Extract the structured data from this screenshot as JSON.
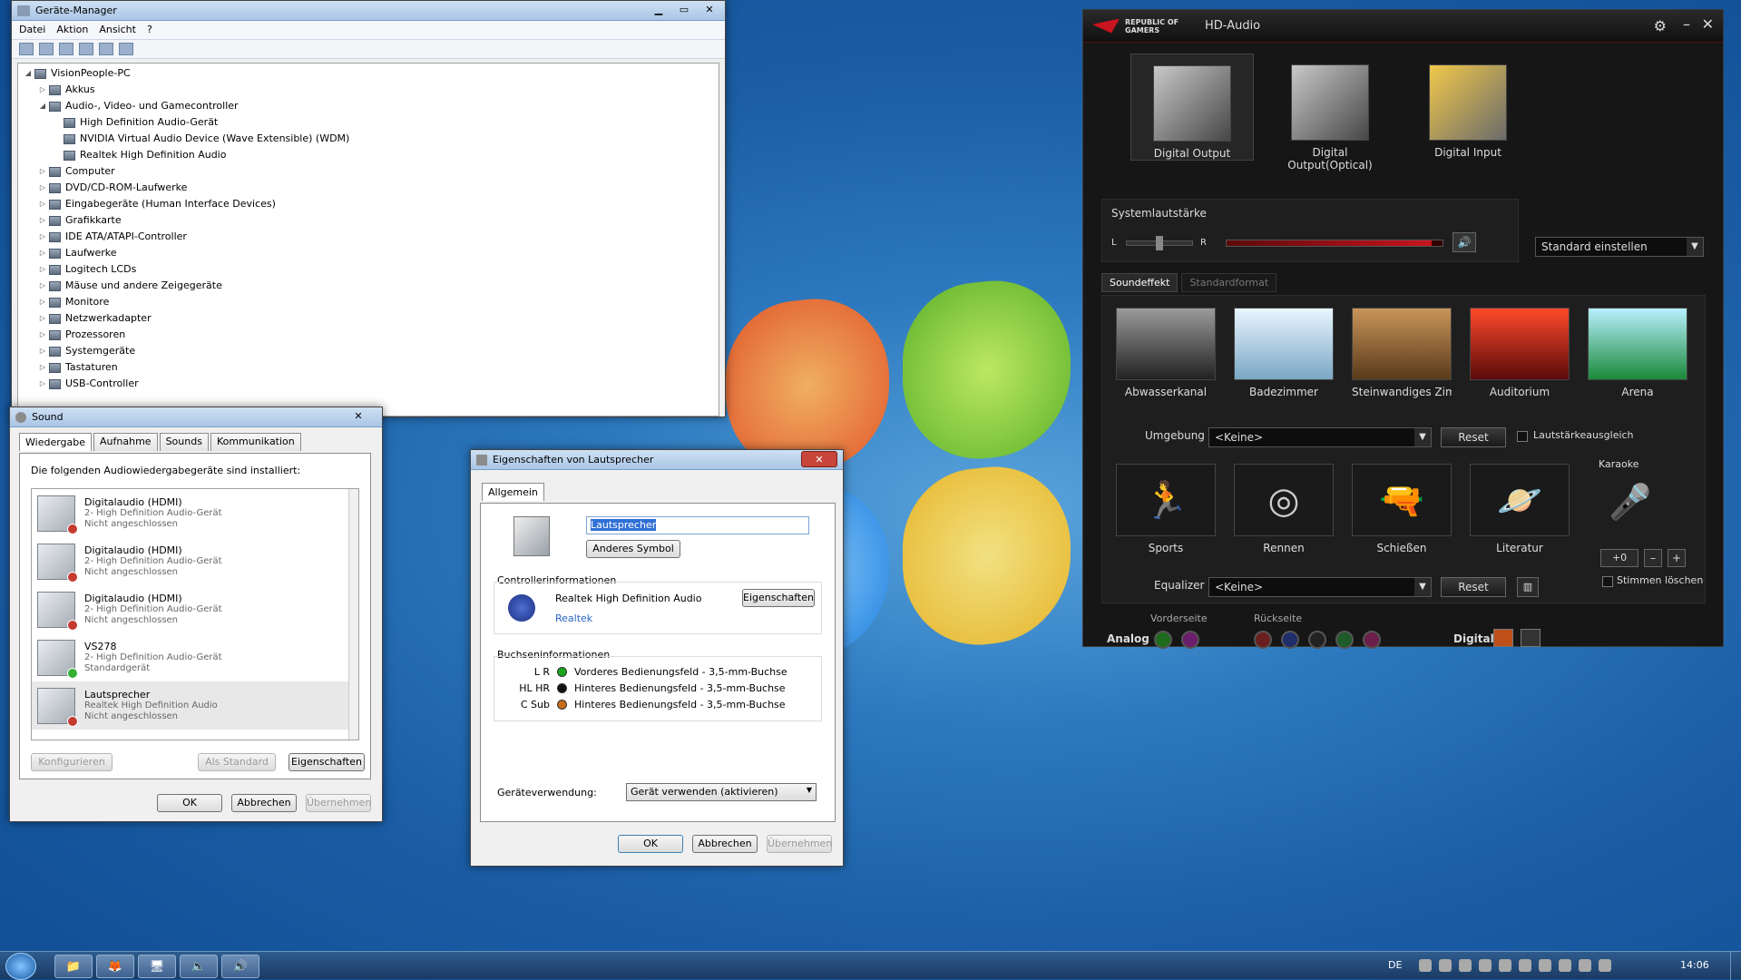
{
  "device_manager": {
    "title": "Geräte-Manager",
    "menu": [
      "Datei",
      "Aktion",
      "Ansicht",
      "?"
    ],
    "tree": [
      {
        "label": "VisionPeople-PC",
        "level": 0,
        "exp": "◢"
      },
      {
        "label": "Akkus",
        "level": 1,
        "exp": "▷"
      },
      {
        "label": "Audio-, Video- und Gamecontroller",
        "level": 1,
        "exp": "◢"
      },
      {
        "label": "High Definition Audio-Gerät",
        "level": 2,
        "exp": ""
      },
      {
        "label": "NVIDIA Virtual Audio Device (Wave Extensible) (WDM)",
        "level": 2,
        "exp": ""
      },
      {
        "label": "Realtek High Definition Audio",
        "level": 2,
        "exp": ""
      },
      {
        "label": "Computer",
        "level": 1,
        "exp": "▷"
      },
      {
        "label": "DVD/CD-ROM-Laufwerke",
        "level": 1,
        "exp": "▷"
      },
      {
        "label": "Eingabegeräte (Human Interface Devices)",
        "level": 1,
        "exp": "▷"
      },
      {
        "label": "Grafikkarte",
        "level": 1,
        "exp": "▷"
      },
      {
        "label": "IDE ATA/ATAPI-Controller",
        "level": 1,
        "exp": "▷"
      },
      {
        "label": "Laufwerke",
        "level": 1,
        "exp": "▷"
      },
      {
        "label": "Logitech LCDs",
        "level": 1,
        "exp": "▷"
      },
      {
        "label": "Mäuse und andere Zeigegeräte",
        "level": 1,
        "exp": "▷"
      },
      {
        "label": "Monitore",
        "level": 1,
        "exp": "▷"
      },
      {
        "label": "Netzwerkadapter",
        "level": 1,
        "exp": "▷"
      },
      {
        "label": "Prozessoren",
        "level": 1,
        "exp": "▷"
      },
      {
        "label": "Systemgeräte",
        "level": 1,
        "exp": "▷"
      },
      {
        "label": "Tastaturen",
        "level": 1,
        "exp": "▷"
      },
      {
        "label": "USB-Controller",
        "level": 1,
        "exp": "▷"
      }
    ]
  },
  "sound": {
    "title": "Sound",
    "tabs": [
      "Wiedergabe",
      "Aufnahme",
      "Sounds",
      "Kommunikation"
    ],
    "intro": "Die folgenden Audiowiedergabegeräte sind installiert:",
    "devices": [
      {
        "name": "Digitalaudio (HDMI)",
        "sub": "2- High Definition Audio-Gerät",
        "status": "Nicht angeschlossen",
        "ok": false
      },
      {
        "name": "Digitalaudio (HDMI)",
        "sub": "2- High Definition Audio-Gerät",
        "status": "Nicht angeschlossen",
        "ok": false
      },
      {
        "name": "Digitalaudio (HDMI)",
        "sub": "2- High Definition Audio-Gerät",
        "status": "Nicht angeschlossen",
        "ok": false
      },
      {
        "name": "VS278",
        "sub": "2- High Definition Audio-Gerät",
        "status": "Standardgerät",
        "ok": true
      },
      {
        "name": "Lautsprecher",
        "sub": "Realtek High Definition Audio",
        "status": "Nicht angeschlossen",
        "ok": false
      }
    ],
    "btn_config": "Konfigurieren",
    "btn_default": "Als Standard",
    "btn_props": "Eigenschaften",
    "ok": "OK",
    "cancel": "Abbrechen",
    "apply": "Übernehmen"
  },
  "props": {
    "title": "Eigenschaften von Lautsprecher",
    "tab": "Allgemein",
    "name_value": "Lautsprecher",
    "btn_symbol": "Anderes Symbol",
    "ctrl_header": "Controllerinformationen",
    "ctrl_name": "Realtek High Definition Audio",
    "ctrl_vendor": "Realtek",
    "btn_ctrl_props": "Eigenschaften",
    "jack_header": "Buchseninformationen",
    "jacks": [
      {
        "ch": "L R",
        "desc": "Vorderes Bedienungsfeld - 3,5-mm-Buchse",
        "color": "#1aa51a"
      },
      {
        "ch": "HL HR",
        "desc": "Hinteres Bedienungsfeld - 3,5-mm-Buchse",
        "color": "#111111"
      },
      {
        "ch": "C Sub",
        "desc": "Hinteres Bedienungsfeld - 3,5-mm-Buchse",
        "color": "#c76a1a"
      }
    ],
    "usage_label": "Geräteverwendung:",
    "usage_value": "Gerät verwenden (aktivieren)",
    "ok": "OK",
    "cancel": "Abbrechen",
    "apply": "Übernehmen"
  },
  "rog": {
    "brand": "REPUBLIC OF GAMERS",
    "title": "HD-Audio",
    "outputs": [
      {
        "label": "Digital Output"
      },
      {
        "label": "Digital Output(Optical)"
      },
      {
        "label": "Digital Input"
      }
    ],
    "vol_label": "Systemlautstärke",
    "vol_l": "L",
    "vol_r": "R",
    "volume_level": 0.95,
    "default_select": "Standard einstellen",
    "tabs": [
      "Soundeffekt",
      "Standardformat"
    ],
    "environments": [
      "Abwasserkanal",
      "Badezimmer",
      "Steinwandiges Zimmer",
      "Auditorium",
      "Arena"
    ],
    "env_label": "Umgebung",
    "env_value": "<Keine>",
    "reset": "Reset",
    "loudness": "Lautstärkeausgleich",
    "eq_presets": [
      "Sports",
      "Rennen",
      "Schießen",
      "Literatur"
    ],
    "karaoke": "Karaoke",
    "karaoke_value": "+0",
    "eq_label": "Equalizer",
    "eq_value": "<Keine>",
    "voice_cancel": "Stimmen löschen",
    "front_label": "Vorderseite",
    "rear_label": "Rückseite",
    "analog": "Analog",
    "digital": "Digital",
    "colors": {
      "accent": "#c8141e"
    }
  },
  "taskbar": {
    "lang": "DE",
    "time": "14:06"
  }
}
